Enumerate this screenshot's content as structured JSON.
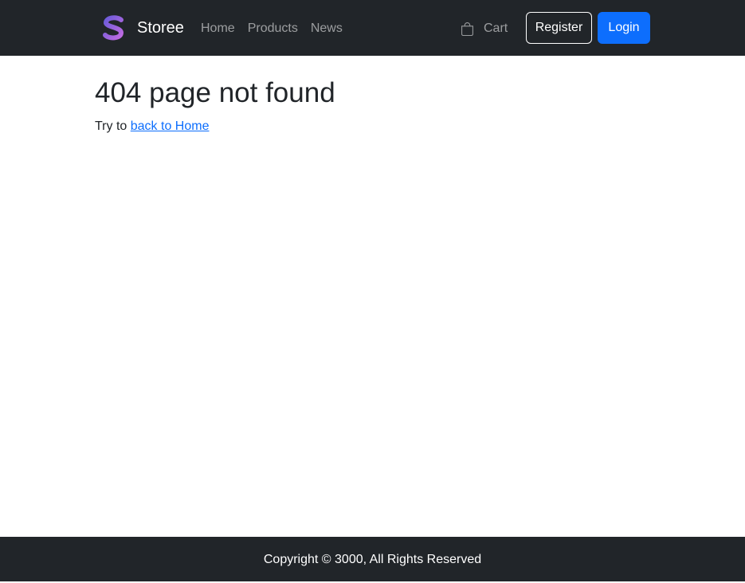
{
  "navbar": {
    "brand_name": "Storee",
    "brand_logo": "s-logo-icon",
    "links": [
      {
        "label": "Home"
      },
      {
        "label": "Products"
      },
      {
        "label": "News"
      }
    ],
    "cart": {
      "label": "Cart",
      "icon": "shopping-bag-icon"
    },
    "register_label": "Register",
    "login_label": "Login"
  },
  "main": {
    "title": "404 page not found",
    "helper_prefix": "Try to ",
    "home_link_label": "back to Home"
  },
  "footer": {
    "copyright": "Copyright © 3000, All Rights Reserved"
  },
  "colors": {
    "navbar_bg": "#212529",
    "accent": "#0d6efd",
    "logo_gradient_start": "#6b5bd9",
    "logo_gradient_end": "#c06be0"
  }
}
